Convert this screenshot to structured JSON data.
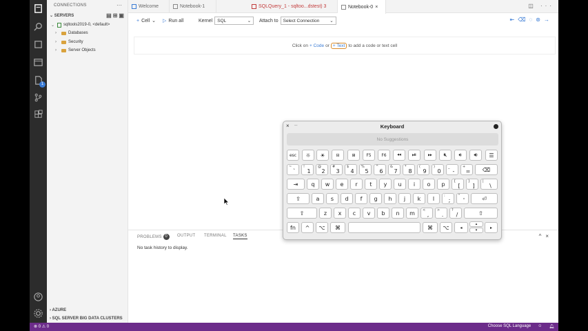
{
  "sidebar": {
    "title": "CONNECTIONS",
    "more": "···",
    "servers_header": "SERVERS",
    "server_name": "sqltools2019-0, <default>",
    "folders": [
      "Databases",
      "Security",
      "Server Objects"
    ],
    "azure": "AZURE",
    "big_data": "SQL SERVER BIG DATA CLUSTERS"
  },
  "tabs": [
    {
      "label": "Welcome"
    },
    {
      "label": "Notebook-1"
    },
    {
      "label": "SQLQuery_1 - sqltoo...dstest) 3"
    },
    {
      "label": "Notebook-0"
    }
  ],
  "toolbar": {
    "cell": "Cell",
    "run_all": "Run all",
    "kernel_label": "Kernel",
    "kernel_value": "SQL",
    "attach_label": "Attach to",
    "attach_value": "Select Connection"
  },
  "editor": {
    "pre": "Click on",
    "code": "+ Code",
    "or": "or",
    "text": "+ Text",
    "post": "to add a code or text cell"
  },
  "panel": {
    "problems": "PROBLEMS",
    "problems_count": "0",
    "output": "OUTPUT",
    "terminal": "TERMINAL",
    "tasks": "TASKS",
    "message": "No task history to display."
  },
  "status": {
    "left": "⊗ 0 ⚠ 0",
    "language": "Choose SQL Language"
  },
  "keyboard": {
    "title": "Keyboard",
    "suggestions": "No Suggestions"
  },
  "colors": {
    "status_bar": "#6c2c8a",
    "activity_bar": "#2c2c2c",
    "accent": "#3a7bd5"
  }
}
